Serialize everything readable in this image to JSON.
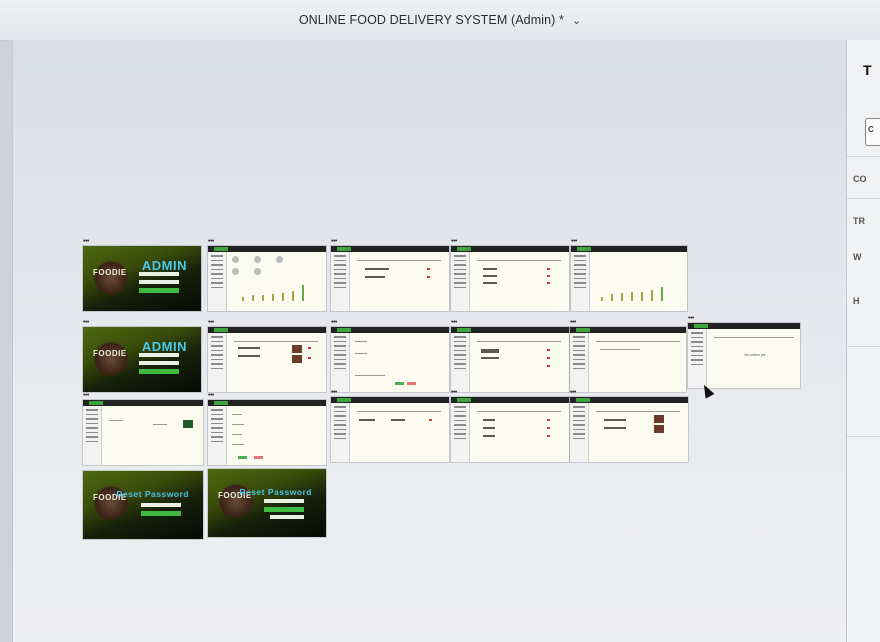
{
  "window": {
    "title": "ONLINE FOOD DELIVERY SYSTEM (Admin) *",
    "menu_icon": "chevron-down-icon"
  },
  "frames": {
    "label": "•••",
    "login_heading": "ADMIN",
    "reset_heading": "Reset Password",
    "brand": "FOODIE",
    "empty_list_text": "No orders yet"
  },
  "right_panel": {
    "items": [
      "T",
      "C",
      "CO",
      "TR",
      "W",
      "H"
    ]
  }
}
